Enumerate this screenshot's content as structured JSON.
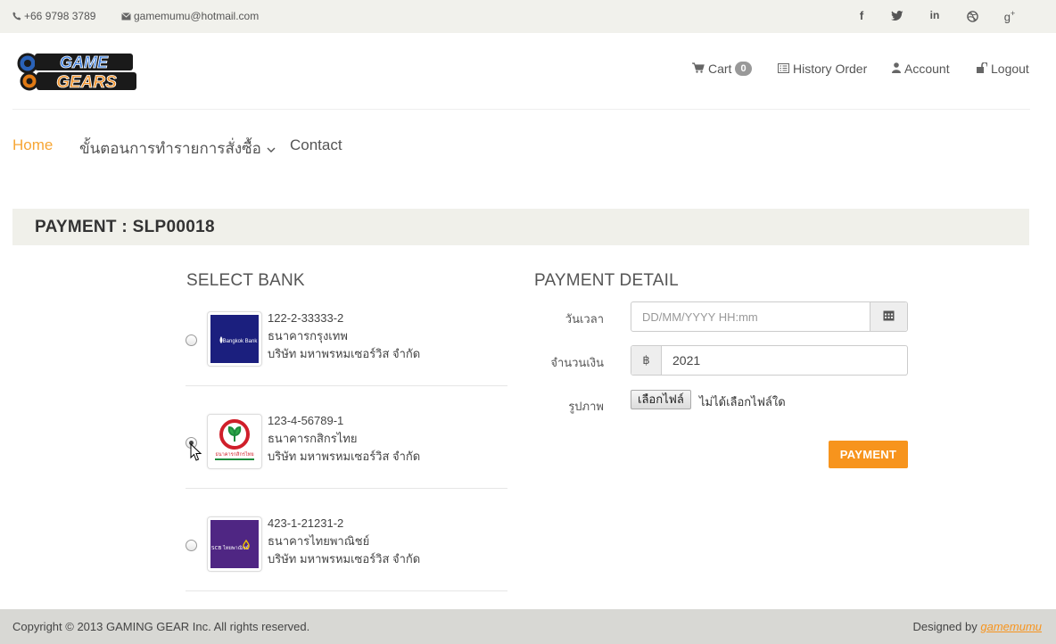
{
  "topbar": {
    "phone": "+66 9798 3789",
    "email": "gamemumu@hotmail.com",
    "social": [
      "facebook-icon",
      "twitter-icon",
      "linkedin-icon",
      "dribbble-icon",
      "google-plus-icon"
    ]
  },
  "header": {
    "logo_line1": "GAME",
    "logo_line2": "GEARS",
    "cart_label": "Cart",
    "cart_count": "0",
    "history_label": "History Order",
    "account_label": "Account",
    "logout_label": "Logout"
  },
  "nav": {
    "home": "Home",
    "steps": "ขั้นตอนการทำรายการสั่งซื้อ",
    "contact": "Contact"
  },
  "page": {
    "title": "PAYMENT : SLP00018"
  },
  "select_bank": {
    "heading": "SELECT BANK",
    "banks": [
      {
        "account": "122-2-33333-2",
        "bank_name": "ธนาคารกรุงเทพ",
        "company": "บริษัท มหาพรหมเซอร์วิส จำกัด",
        "logo_text": "Bangkok Bank",
        "selected": false
      },
      {
        "account": "123-4-56789-1",
        "bank_name": "ธนาคารกสิกรไทย",
        "company": "บริษัท มหาพรหมเซอร์วิส จำกัด",
        "logo_text": "ธนาคารกสิกรไทย",
        "selected": true
      },
      {
        "account": "423-1-21231-2",
        "bank_name": "ธนาคารไทยพาณิชย์",
        "company": "บริษัท มหาพรหมเซอร์วิส จำกัด",
        "logo_text": "SCB ไทยพาณิชย์",
        "selected": false
      }
    ]
  },
  "payment_detail": {
    "heading": "PAYMENT DETAIL",
    "datetime_label": "วันเวลา",
    "datetime_placeholder": "DD/MM/YYYY HH:mm",
    "amount_label": "จำนวนเงิน",
    "currency": "฿",
    "amount_value": "2021",
    "image_label": "รูปภาพ",
    "file_button": "เลือกไฟล์",
    "file_status": "ไม่ได้เลือกไฟล์ใด",
    "submit_label": "PAYMENT"
  },
  "footer": {
    "copyright": "Copyright © 2013 GAMING GEAR Inc. All rights reserved.",
    "designed_by": "Designed by",
    "designer": "gamemumu"
  },
  "colors": {
    "accent": "#f7941d",
    "nav_active": "#f7a635",
    "band": "#f0f0ea",
    "footer": "#d8d8d4"
  }
}
